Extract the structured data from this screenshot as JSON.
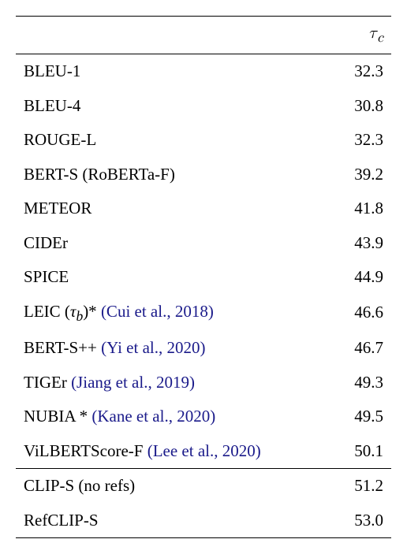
{
  "chart_data": {
    "type": "table",
    "header": {
      "left": "",
      "right": "τc"
    },
    "groups": [
      {
        "rows": [
          {
            "name": "BLEU-1",
            "cite": "",
            "value": "32.3"
          },
          {
            "name": "BLEU-4",
            "cite": "",
            "value": "30.8"
          },
          {
            "name": "ROUGE-L",
            "cite": "",
            "value": "32.3"
          },
          {
            "name": "BERT-S (RoBERTa-F)",
            "cite": "",
            "value": "39.2"
          },
          {
            "name": "METEOR",
            "cite": "",
            "value": "41.8"
          },
          {
            "name": "CIDEr",
            "cite": "",
            "value": "43.9"
          },
          {
            "name": "SPICE",
            "cite": "",
            "value": "44.9"
          },
          {
            "name": "LEIC (τb)* ",
            "cite": "(Cui et al., 2018)",
            "value": "46.6"
          },
          {
            "name": "BERT-S++ ",
            "cite": "(Yi et al., 2020)",
            "value": "46.7"
          },
          {
            "name": "TIGEr ",
            "cite": "(Jiang et al., 2019)",
            "value": "49.3"
          },
          {
            "name": "NUBIA * ",
            "cite": "(Kane et al., 2020)",
            "value": "49.5"
          },
          {
            "name": "ViLBERTScore-F ",
            "cite": "(Lee et al., 2020)",
            "value": "50.1"
          }
        ]
      },
      {
        "rows": [
          {
            "name": "CLIP-S (no refs)",
            "cite": "",
            "value": "51.2"
          },
          {
            "name": "RefCLIP-S",
            "cite": "",
            "value": "53.0"
          }
        ]
      }
    ]
  }
}
